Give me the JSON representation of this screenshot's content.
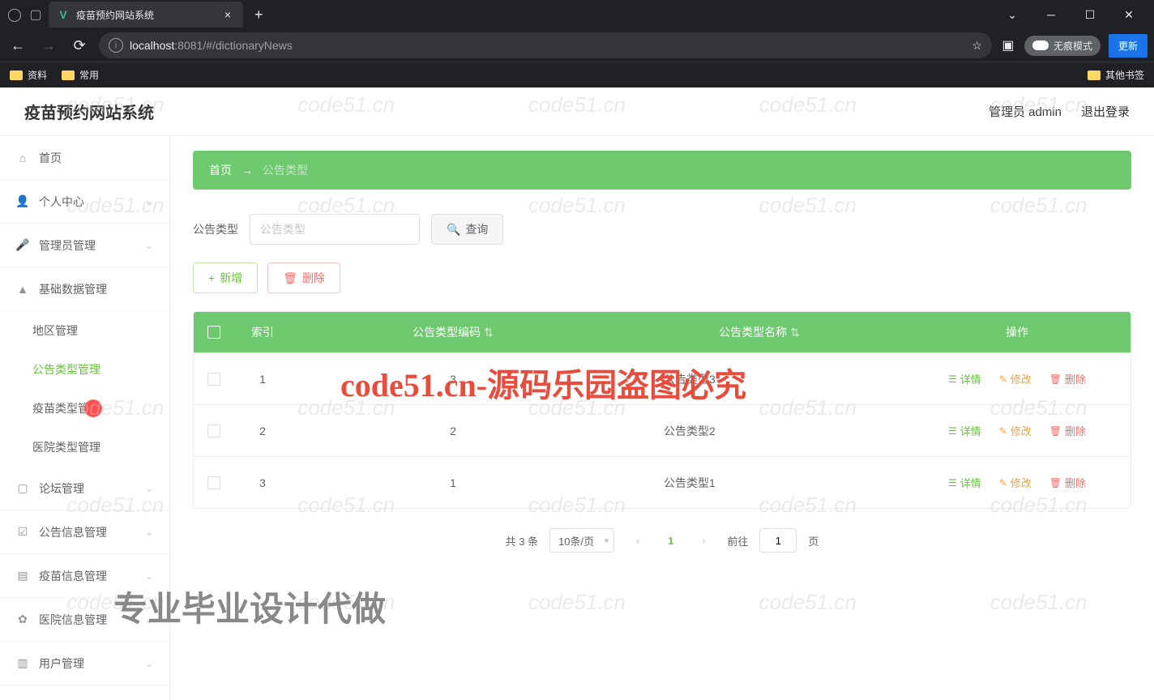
{
  "browser": {
    "tab_title": "疫苗预约网站系统",
    "url_host": "localhost",
    "url_port": ":8081",
    "url_path": "/#/dictionaryNews",
    "incognito_label": "无痕模式",
    "update_label": "更新",
    "bookmarks": {
      "b1": "资料",
      "b2": "常用",
      "b3": "其他书签"
    }
  },
  "app": {
    "title": "疫苗预约网站系统",
    "user_label": "管理员 admin",
    "logout": "退出登录"
  },
  "sidebar": {
    "home": "首页",
    "personal": "个人中心",
    "admin_mgmt": "管理员管理",
    "base_data": "基础数据管理",
    "region": "地区管理",
    "notice_type": "公告类型管理",
    "vaccine_type": "疫苗类型管理",
    "hospital_type": "医院类型管理",
    "forum": "论坛管理",
    "notice_info": "公告信息管理",
    "vaccine_info": "疫苗信息管理",
    "hospital_info": "医院信息管理",
    "user_mgmt": "用户管理"
  },
  "breadcrumb": {
    "home": "首页",
    "current": "公告类型"
  },
  "search": {
    "label": "公告类型",
    "placeholder": "公告类型",
    "query_btn": "查询"
  },
  "actions": {
    "add": "新增",
    "delete": "删除"
  },
  "table": {
    "headers": {
      "index": "索引",
      "code": "公告类型编码",
      "name": "公告类型名称",
      "ops": "操作"
    },
    "rows": [
      {
        "idx": "1",
        "code": "3",
        "name": "公告类型3"
      },
      {
        "idx": "2",
        "code": "2",
        "name": "公告类型2"
      },
      {
        "idx": "3",
        "code": "1",
        "name": "公告类型1"
      }
    ],
    "op_detail": "详情",
    "op_edit": "修改",
    "op_delete": "删除"
  },
  "pagination": {
    "total": "共 3 条",
    "per_page": "10条/页",
    "current": "1",
    "goto_prefix": "前往",
    "goto_suffix": "页",
    "goto_value": "1"
  },
  "watermark": {
    "text": "code51.cn",
    "big": "code51.cn-源码乐园盗图必究",
    "bottom": "专业毕业设计代做"
  }
}
